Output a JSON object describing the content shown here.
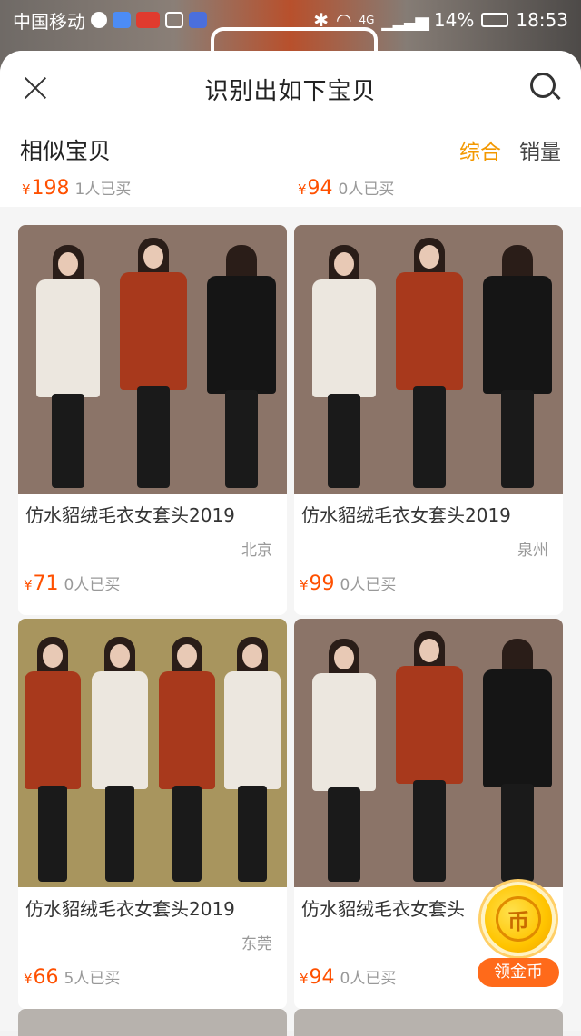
{
  "status_bar": {
    "carrier": "中国移动",
    "network": "4G",
    "battery": "14%",
    "time": "18:53"
  },
  "sheet": {
    "title": "识别出如下宝贝"
  },
  "section": {
    "title": "相似宝贝",
    "sort_tabs": [
      {
        "label": "综合",
        "active": true
      },
      {
        "label": "销量",
        "active": false
      }
    ]
  },
  "top_partial": [
    {
      "price": "198",
      "sold": "1人已买"
    },
    {
      "price": "94",
      "sold": "0人已买"
    }
  ],
  "currency_symbol": "¥",
  "products": [
    {
      "name": "仿水貂绒毛衣女套头2019",
      "location": "北京",
      "price": "71",
      "sold": "0人已买"
    },
    {
      "name": "仿水貂绒毛衣女套头2019",
      "location": "泉州",
      "price": "99",
      "sold": "0人已买"
    },
    {
      "name": "仿水貂绒毛衣女套头2019",
      "location": "东莞",
      "price": "66",
      "sold": "5人已买"
    },
    {
      "name": "仿水貂绒毛衣女套头",
      "location": "",
      "price": "94",
      "sold": "0人已买"
    }
  ],
  "floating": {
    "coin_glyph": "币",
    "coin_label": "领金币"
  },
  "colors": {
    "price": "#ff5000",
    "active_tab": "#f39800",
    "coin_button": "#ff6a1a"
  }
}
